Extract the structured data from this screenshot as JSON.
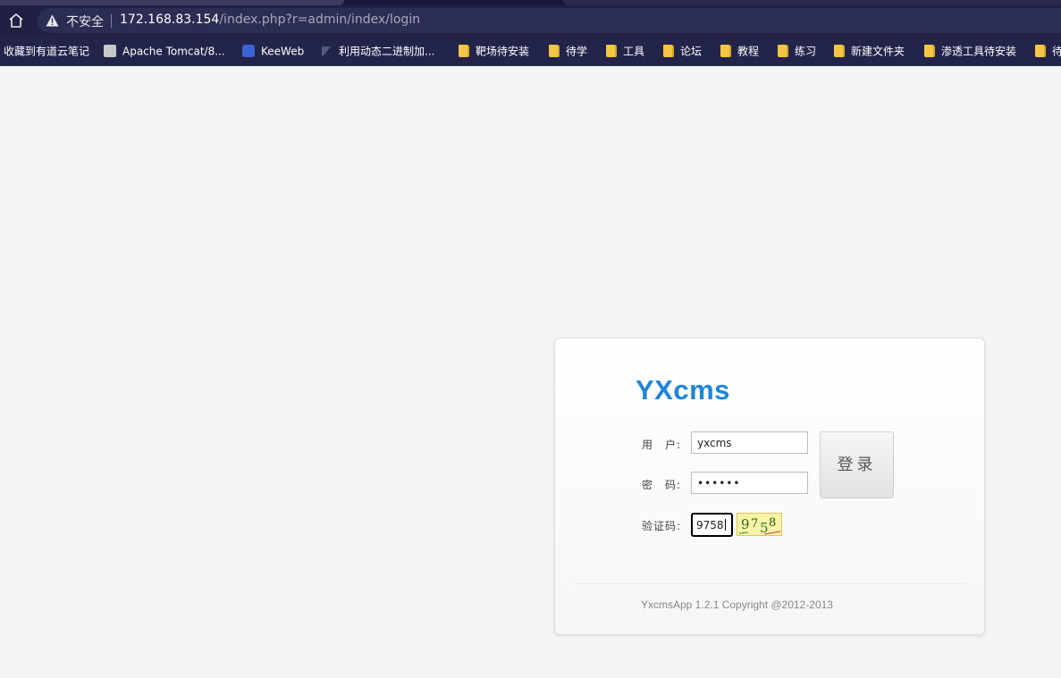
{
  "browser": {
    "security_label": "不安全",
    "url_host": "172.168.83.154",
    "url_path": "/index.php?r=admin/index/login",
    "bookmarks": [
      {
        "label": "收藏到有道云笔记",
        "icon": "none"
      },
      {
        "label": "Apache Tomcat/8...",
        "icon": "tomcat-icon"
      },
      {
        "label": "KeeWeb",
        "icon": "keeweb-icon"
      },
      {
        "label": "利用动态二进制加...",
        "icon": "page-icon"
      },
      {
        "label": "靶场待安装",
        "icon": "folder-icon"
      },
      {
        "label": "待学",
        "icon": "folder-icon"
      },
      {
        "label": "工具",
        "icon": "folder-icon"
      },
      {
        "label": "论坛",
        "icon": "folder-icon"
      },
      {
        "label": "教程",
        "icon": "folder-icon"
      },
      {
        "label": "练习",
        "icon": "folder-icon"
      },
      {
        "label": "新建文件夹",
        "icon": "folder-icon"
      },
      {
        "label": "渗透工具待安装",
        "icon": "folder-icon"
      },
      {
        "label": "待",
        "icon": "folder-icon"
      }
    ]
  },
  "login": {
    "logo": "YXcms",
    "username_label": "用　户:",
    "username_value": "yxcms",
    "password_label": "密　码:",
    "password_value": "••••••",
    "captcha_label": "验证码:",
    "captcha_value": "9758",
    "captcha_image_text": [
      "9",
      "7",
      "5",
      "8"
    ],
    "login_button": "登录",
    "copyright": "YxcmsApp 1.2.1 Copyright @2012-2013"
  },
  "colors": {
    "logo": "#1d86da",
    "chrome_bg": "#1f2044",
    "page_bg": "#f5f5f5",
    "captcha_bg": "#f8f3a8"
  }
}
